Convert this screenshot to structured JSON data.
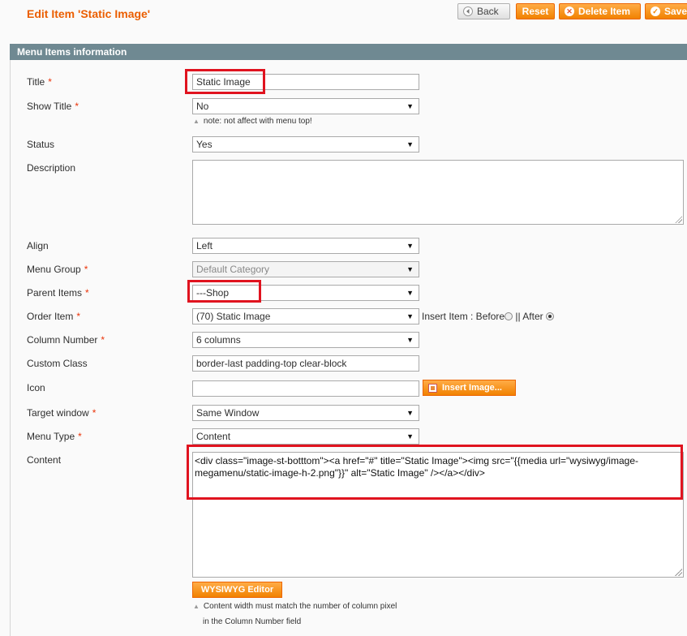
{
  "header": {
    "title": "Edit Item 'Static Image'",
    "back_label": "Back",
    "reset_label": "Reset",
    "delete_label": "Delete Item",
    "save_label": "Save"
  },
  "section": {
    "title": "Menu Items information"
  },
  "form": {
    "title": {
      "label": "Title",
      "value": "Static Image"
    },
    "show_title": {
      "label": "Show Title",
      "value": "No",
      "note": "note: not affect with menu top!"
    },
    "status": {
      "label": "Status",
      "value": "Yes"
    },
    "description": {
      "label": "Description",
      "value": ""
    },
    "align": {
      "label": "Align",
      "value": "Left"
    },
    "menu_group": {
      "label": "Menu Group",
      "value": "Default Category"
    },
    "parent_items": {
      "label": "Parent Items",
      "value": "---Shop"
    },
    "order_item": {
      "label": "Order Item",
      "value": "(70) Static Image",
      "insert_label": "Insert Item : Before",
      "after_label": "|| After"
    },
    "column_number": {
      "label": "Column Number",
      "value": "6 columns"
    },
    "custom_class": {
      "label": "Custom Class",
      "value": "border-last padding-top clear-block"
    },
    "icon": {
      "label": "Icon",
      "value": "",
      "button_label": "Insert Image..."
    },
    "target_window": {
      "label": "Target window",
      "value": "Same Window"
    },
    "menu_type": {
      "label": "Menu Type",
      "value": "Content"
    },
    "content": {
      "label": "Content",
      "line1": "<div class=\"image-st-botttom\"><a href=\"#\" title=\"Static Image\"><img src=\"{{media url=\"wysiwyg/image-",
      "line2": "megamenu/static-image-h-2.png\"}}\" alt=\"Static Image\" /></a></div>",
      "editor_button": "WYSIWYG Editor",
      "note_line1": "Content width must match the number of column pixel",
      "note_line2": "in the Column Number field"
    },
    "required_mark": "*"
  },
  "colors": {
    "accent": "#eb5e00",
    "header_bar": "#6f8992",
    "highlight": "#e0131f"
  }
}
